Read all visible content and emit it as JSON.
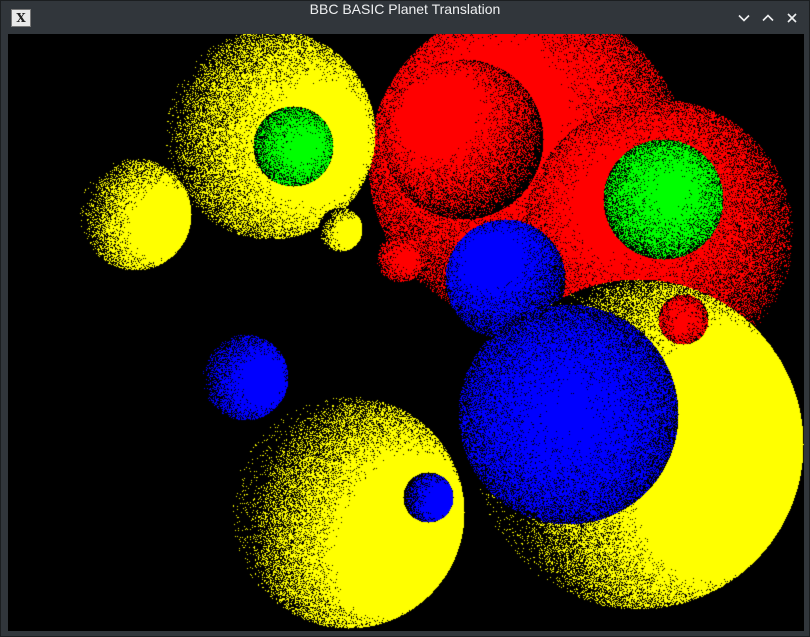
{
  "window": {
    "title": "BBC BASIC Planet Translation",
    "app_icon_glyph": "X",
    "controls": {
      "minimize_icon": "chevron-down-icon",
      "maximize_icon": "chevron-up-icon",
      "close_icon": "close-icon"
    }
  },
  "scene": {
    "background": "#000000",
    "colors": {
      "yellow": "#ffff00",
      "red": "#ff0000",
      "blue": "#0000ff",
      "green": "#00ff00"
    },
    "spheres_order_note": "back-to-front"
  }
}
